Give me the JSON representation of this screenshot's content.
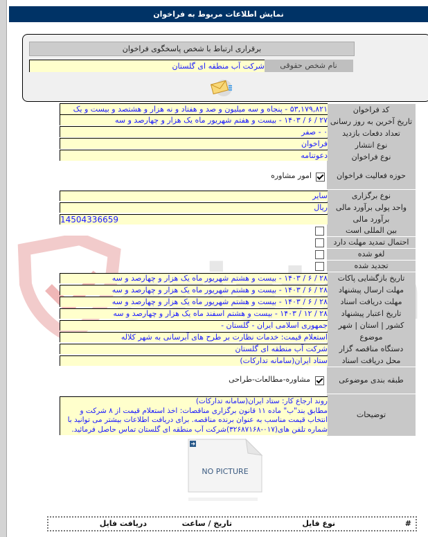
{
  "header": {
    "title": "نمایش اطلاعات مربوط به فراخوان"
  },
  "contact": {
    "title": "برقراری ارتباط با شخص پاسخگوی فراخوان",
    "label": "نام شخص حقوقی",
    "value": "شرکت آب منطقه ای گلستان",
    "mail_icon": "envelope-icon"
  },
  "fields": {
    "code": {
      "label": "کد فراخوان",
      "value": "۵۳,۱۷۹,۸۲۱ - پنجاه و سه میلیون و صد و هفتاد و نه هزار و هشتصد و بیست و یک"
    },
    "last_update": {
      "label": "تاریخ آخرین به روز رسانی",
      "value": "۲۷ / ۶ / ۱۴۰۳ - بیست و هفتم شهریور ماه یک هزار و چهارصد و سه"
    },
    "visits": {
      "label": "تعداد دفعات بازدید",
      "value": "۰ - صفر"
    },
    "publish_type": {
      "label": "نوع انتشار",
      "value": "فراخوان"
    },
    "call_type": {
      "label": "نوع فراخوان",
      "value": "دعوتنامه"
    },
    "activity": {
      "label": "حوزه فعالیت فراخوان",
      "option": "امور مشاوره",
      "checked": true
    },
    "holding_type": {
      "label": "نوع برگزاری",
      "value": "سایر"
    },
    "currency": {
      "label": "واحد پولی برآورد مالی",
      "value": "ریال"
    },
    "estimate": {
      "label": "برآورد مالی",
      "value": "14504336659"
    },
    "international": {
      "label": "بین المللی است",
      "checked": false
    },
    "extension": {
      "label": "احتمال تمدید مهلت دارد",
      "checked": false
    },
    "canceled": {
      "label": "لغو شده",
      "checked": false
    },
    "renewed": {
      "label": "تجدید شده",
      "checked": false
    },
    "opening_date": {
      "label": "تاریخ بازگشایی پاکات",
      "value": "۲۸ / ۶ / ۱۴۰۳ - بیست و هشتم شهریور ماه یک هزار و چهارصد و سه"
    },
    "submit_deadline": {
      "label": "مهلت ارسال پیشنهاد",
      "value": "۲۸ / ۶ / ۱۴۰۳ - بیست و هشتم شهریور ماه یک هزار و چهارصد و سه"
    },
    "docs_deadline": {
      "label": "مهلت دریافت اسناد",
      "value": "۲۸ / ۶ / ۱۴۰۳ - بیست و هشتم شهریور ماه یک هزار و چهارصد و سه"
    },
    "validity_date": {
      "label": "تاریخ اعتبار پیشنهاد",
      "value": "۲۸ / ۱۲ / ۱۴۰۳ - بیست و هشتم اسفند ماه یک هزار و چهارصد و سه"
    },
    "location": {
      "label": "کشور | استان | شهر",
      "value": "جمهوری اسلامی ایران - گلستان -"
    },
    "subject": {
      "label": "موضوع",
      "value": "استعلام قیمت: خدمات نظارت بر طرح های آبرسانی به شهر کلاله"
    },
    "organizer": {
      "label": "دستگاه مناقصه گزار",
      "value": "شرکت آب منطقه ای گلستان"
    },
    "docs_place": {
      "label": "محل دریافت اسناد",
      "value": "ستاد ایران(سامانه تدارکات)"
    },
    "category": {
      "label": "طبقه بندی موضوعی",
      "option": "مشاوره-مطالعات-طراحی",
      "checked": true
    },
    "description": {
      "label": "توضیحات",
      "lines": [
        "روند ارجاع کار: ستاد ایران(سامانه تدارکات)",
        "مطابق بند\"ب\" ماده ۱۱ قانون برگزاری مناقصات: اخذ استعلام قیمت از ۸ شرکت و",
        "انتخاب قیمت مناسب به عنوان برنده مناقصه. برای دریافت اطلاعات بیشتر می توانید با",
        "شماره تلفن های(۰۱۷-۳۲۶۸۷۱۶۸)شرکت آب منطقه ای گلستان تماس حاصل فرمائید."
      ]
    }
  },
  "picture": {
    "placeholder": "NO PICTURE"
  },
  "files_table": {
    "columns": [
      "#",
      "نوع فایل",
      "تاریخ / ساعت",
      "دریافت فایل"
    ]
  },
  "watermark": {
    "text": "ariatender.net"
  }
}
